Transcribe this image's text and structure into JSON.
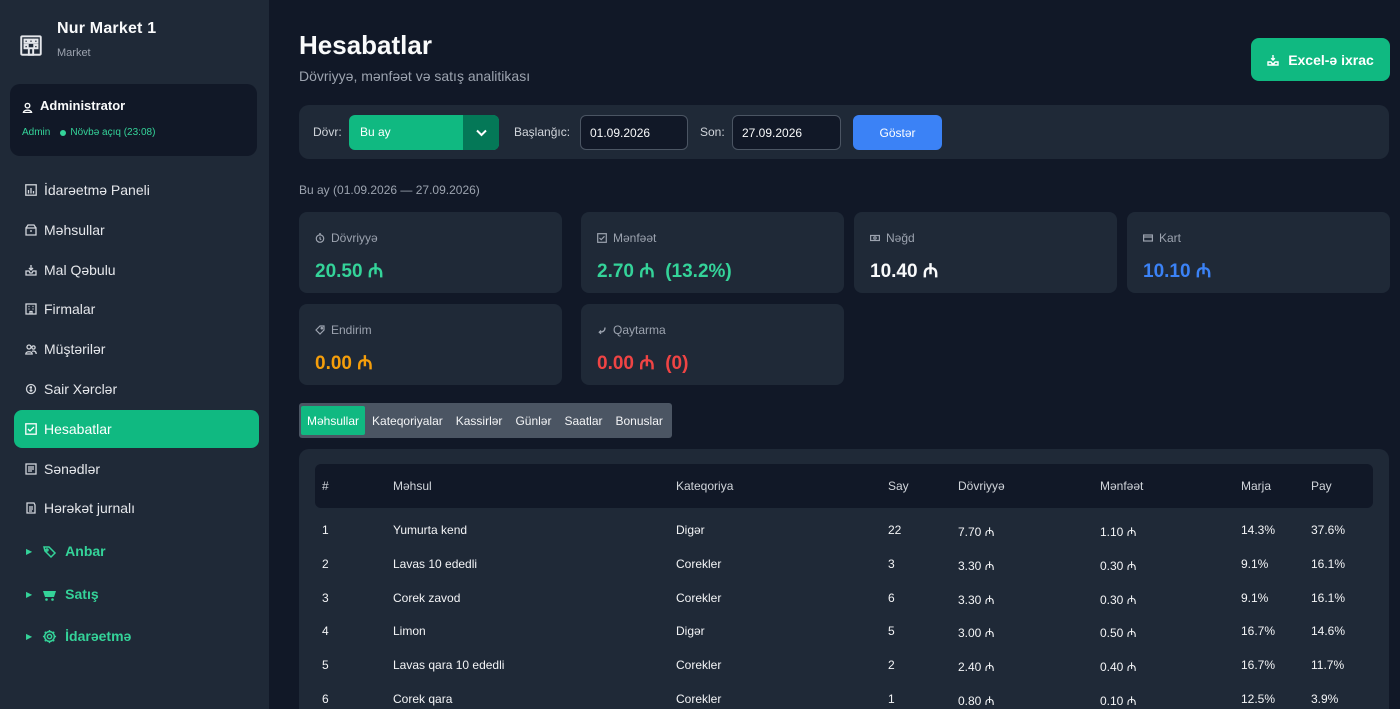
{
  "sidebar": {
    "brand_title": "Nur Market 1",
    "brand_sub": "Market",
    "user": {
      "name": "Administrator",
      "role": "Admin",
      "shift": "Növbə açıq (23:08)"
    },
    "items": [
      {
        "label": "İdarəetmə Paneli",
        "icon": "chart-icon"
      },
      {
        "label": "Məhsullar",
        "icon": "box-icon"
      },
      {
        "label": "Mal Qəbulu",
        "icon": "inbox-icon"
      },
      {
        "label": "Firmalar",
        "icon": "building-icon"
      },
      {
        "label": "Müştərilər",
        "icon": "users-icon"
      },
      {
        "label": "Sair Xərclər",
        "icon": "expense-icon"
      },
      {
        "label": "Hesabatlar",
        "icon": "check-icon",
        "active": true
      },
      {
        "label": "Sənədlər",
        "icon": "document-icon"
      },
      {
        "label": "Hərəkət jurnalı",
        "icon": "journal-icon"
      }
    ],
    "groups": [
      {
        "label": "Anbar",
        "icon": "warehouse-icon"
      },
      {
        "label": "Satış",
        "icon": "cart-icon"
      },
      {
        "label": "İdarəetmə",
        "icon": "gear-icon"
      }
    ]
  },
  "header": {
    "title": "Hesabatlar",
    "subtitle": "Dövriyyə, mənfəət və satış analitikası",
    "export_label": "Excel-ə ixrac"
  },
  "filters": {
    "period_label": "Dövr:",
    "period_value": "Bu ay",
    "start_label": "Başlanğıc:",
    "start_value": "01.09.2026",
    "end_label": "Son:",
    "end_value": "27.09.2026",
    "show_label": "Göstər"
  },
  "period_note": "Bu ay (01.09.2026 — 27.09.2026)",
  "stats": [
    {
      "label": "Dövriyyə",
      "value": "20.50 ₼",
      "color": "#34d399",
      "icon": "stopwatch-icon"
    },
    {
      "label": "Mənfəət",
      "value": "2.70 ₼  (13.2%)",
      "color": "#34d399",
      "icon": "check-icon"
    },
    {
      "label": "Nəğd",
      "value": "10.40 ₼",
      "color": "#f9fafb",
      "icon": "cash-icon"
    },
    {
      "label": "Kart",
      "value": "10.10 ₼",
      "color": "#3b82f6",
      "icon": "card-icon"
    },
    {
      "label": "Endirim",
      "value": "0.00 ₼",
      "color": "#f59e0b",
      "icon": "tag-icon"
    },
    {
      "label": "Qaytarma",
      "value": "0.00 ₼  (0)",
      "color": "#ef4444",
      "icon": "return-icon"
    }
  ],
  "tabs": [
    "Məhsullar",
    "Kateqoriyalar",
    "Kassirlər",
    "Günlər",
    "Saatlar",
    "Bonuslar"
  ],
  "table": {
    "headers": [
      "#",
      "Məhsul",
      "Kateqoriya",
      "Say",
      "Dövriyyə",
      "Mənfəət",
      "Marja",
      "Pay"
    ],
    "rows": [
      [
        "1",
        "Yumurta kend",
        "Digər",
        "22",
        "7.70 ₼",
        "1.10 ₼",
        "14.3%",
        "37.6%"
      ],
      [
        "2",
        "Lavas 10 ededli",
        "Corekler",
        "3",
        "3.30 ₼",
        "0.30 ₼",
        "9.1%",
        "16.1%"
      ],
      [
        "3",
        "Corek zavod",
        "Corekler",
        "6",
        "3.30 ₼",
        "0.30 ₼",
        "9.1%",
        "16.1%"
      ],
      [
        "4",
        "Limon",
        "Digər",
        "5",
        "3.00 ₼",
        "0.50 ₼",
        "16.7%",
        "14.6%"
      ],
      [
        "5",
        "Lavas qara 10 ededli",
        "Corekler",
        "2",
        "2.40 ₼",
        "0.40 ₼",
        "16.7%",
        "11.7%"
      ],
      [
        "6",
        "Corek qara",
        "Corekler",
        "1",
        "0.80 ₼",
        "0.10 ₼",
        "12.5%",
        "3.9%"
      ]
    ]
  },
  "colors": {
    "accent": "#10b981",
    "accent_dark": "#047857",
    "blue": "#3b82f6"
  }
}
